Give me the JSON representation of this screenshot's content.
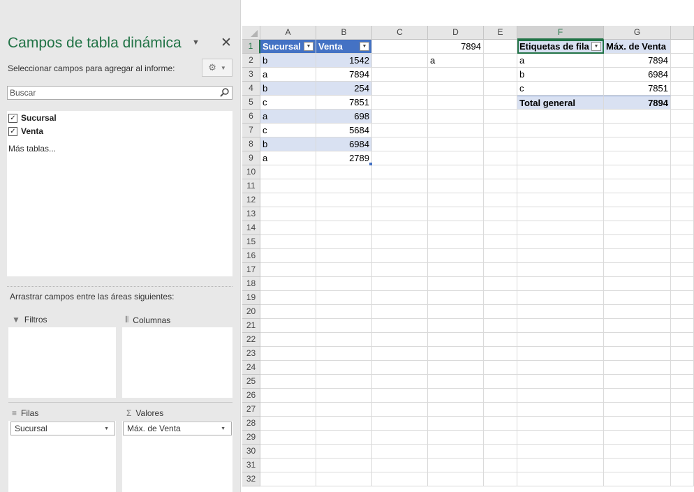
{
  "panel": {
    "title": "Campos de tabla dinámica",
    "subtitle": "Seleccionar campos para agregar al informe:",
    "search_placeholder": "Buscar",
    "fields": [
      "Sucursal",
      "Venta"
    ],
    "more_tables": "Más tablas...",
    "drag_label": "Arrastrar campos entre las áreas siguientes:",
    "areas": {
      "filters": "Filtros",
      "columns": "Columnas",
      "rows": "Filas",
      "values": "Valores"
    },
    "rows_field": "Sucursal",
    "values_field": "Máx. de Venta"
  },
  "sheet": {
    "columns": [
      "A",
      "B",
      "C",
      "D",
      "E",
      "F",
      "G"
    ],
    "rows": [
      "1",
      "2",
      "3",
      "4",
      "5",
      "6",
      "7",
      "8",
      "9",
      "10",
      "11",
      "12",
      "13",
      "14",
      "15",
      "16",
      "17",
      "18",
      "19",
      "20",
      "21",
      "22",
      "23",
      "24",
      "25",
      "26",
      "27",
      "28",
      "29",
      "30",
      "31",
      "32"
    ],
    "selected_column": "F",
    "selected_row": "1",
    "table": {
      "headers": [
        "Sucursal",
        "Venta"
      ],
      "rows": [
        [
          "b",
          "1542"
        ],
        [
          "a",
          "7894"
        ],
        [
          "b",
          "254"
        ],
        [
          "c",
          "7851"
        ],
        [
          "a",
          "698"
        ],
        [
          "c",
          "5684"
        ],
        [
          "b",
          "6984"
        ],
        [
          "a",
          "2789"
        ]
      ]
    },
    "d1": "7894",
    "c2": "a",
    "pivot": {
      "header_label": "Etiquetas de fila",
      "header_value": "Máx. de Venta",
      "rows": [
        [
          "a",
          "7894"
        ],
        [
          "b",
          "6984"
        ],
        [
          "c",
          "7851"
        ]
      ],
      "total_label": "Total general",
      "total_value": "7894"
    }
  }
}
